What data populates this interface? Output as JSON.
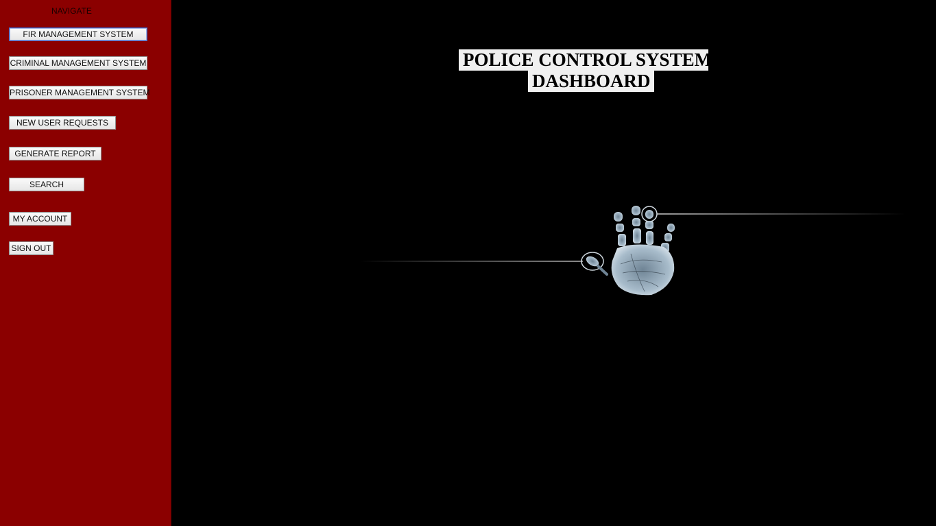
{
  "sidebar": {
    "title": "NAVIGATE",
    "buttons": [
      {
        "label": "FIR MANAGEMENT SYSTEM"
      },
      {
        "label": "CRIMINAL MANAGEMENT SYSTEM"
      },
      {
        "label": "PRISONER MANAGEMENT SYSTEM"
      },
      {
        "label": "NEW USER REQUESTS"
      },
      {
        "label": "GENERATE REPORT"
      },
      {
        "label": "SEARCH"
      },
      {
        "label": "MY ACCOUNT"
      },
      {
        "label": "SIGN OUT"
      }
    ]
  },
  "main": {
    "title_line1": "POLICE CONTROL SYSTEM",
    "title_line2": "DASHBOARD",
    "image": "handprint-graphic"
  },
  "colors": {
    "sidebar_bg": "#8b0000",
    "main_bg": "#000000",
    "title_bg": "#f0f0f0"
  }
}
